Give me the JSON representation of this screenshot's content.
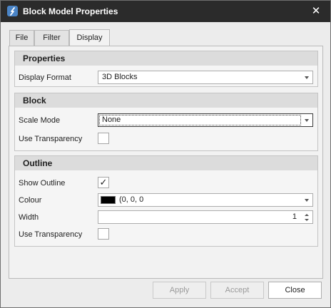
{
  "window": {
    "title": "Block Model Properties",
    "close_glyph": "✕"
  },
  "tabs": [
    {
      "label": "File"
    },
    {
      "label": "Filter"
    },
    {
      "label": "Display"
    }
  ],
  "groups": {
    "properties": {
      "title": "Properties",
      "display_format": {
        "label": "Display Format",
        "value": "3D Blocks"
      }
    },
    "block": {
      "title": "Block",
      "scale_mode": {
        "label": "Scale Mode",
        "value": "None"
      },
      "use_transparency": {
        "label": "Use Transparency",
        "checked": false
      }
    },
    "outline": {
      "title": "Outline",
      "show_outline": {
        "label": "Show Outline",
        "checked": true,
        "check_glyph": "✓"
      },
      "colour": {
        "label": "Colour",
        "value": "(0, 0, 0",
        "swatch_color": "#000000"
      },
      "width": {
        "label": "Width",
        "value": "1"
      },
      "use_transparency": {
        "label": "Use Transparency",
        "checked": false
      }
    }
  },
  "buttons": {
    "apply": "Apply",
    "accept": "Accept",
    "close": "Close"
  },
  "colors": {
    "titlebar": "#2b2b2b",
    "icon_accent": "#4a84c6"
  }
}
